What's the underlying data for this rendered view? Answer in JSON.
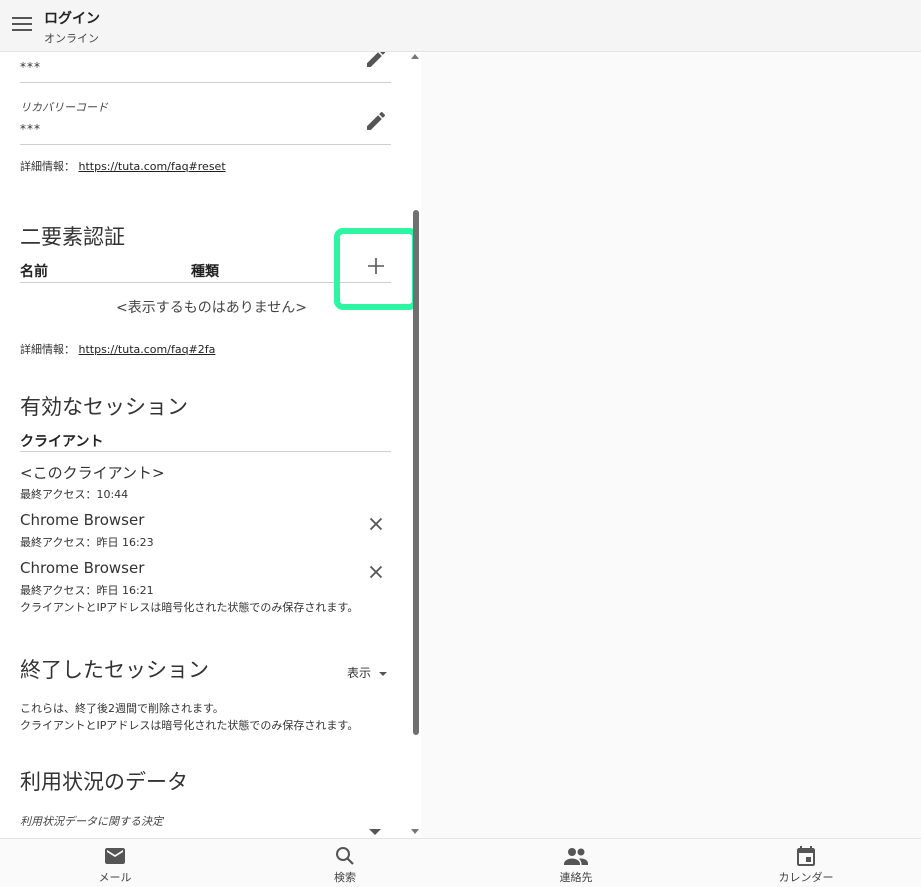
{
  "header": {
    "title": "ログイン",
    "subtitle": "オンライン"
  },
  "password": {
    "value": "***"
  },
  "recovery": {
    "label": "リカバリーコード",
    "value": "***"
  },
  "reset_info": {
    "label": "詳細情報：",
    "link": "https://tuta.com/faq#reset"
  },
  "two_factor": {
    "title": "二要素認証",
    "col_name": "名前",
    "col_type": "種類",
    "empty": "<表示するものはありません>",
    "info_label": "詳細情報：",
    "info_link": "https://tuta.com/faq#2fa"
  },
  "active_sessions": {
    "title": "有効なセッション",
    "col_client": "クライアント",
    "sessions": [
      {
        "name": "<このクライアント>",
        "last_access": "最終アクセス：10:44"
      },
      {
        "name": "Chrome Browser",
        "last_access": "最終アクセス：昨日 16:23"
      },
      {
        "name": "Chrome Browser",
        "last_access": "最終アクセス：昨日 16:21"
      }
    ],
    "note": "クライアントとIPアドレスは暗号化された状態でのみ保存されます。"
  },
  "closed_sessions": {
    "title": "終了したセッション",
    "show_label": "表示",
    "note1": "これらは、終了後2週間で削除されます。",
    "note2": "クライアントとIPアドレスは暗号化された状態でのみ保存されます。"
  },
  "usage_data": {
    "title": "利用状況のデータ",
    "decision_label": "利用状況データに関する決定"
  },
  "nav": {
    "mail": "メール",
    "search": "検索",
    "contacts": "連絡先",
    "calendar": "カレンダー"
  },
  "colors": {
    "highlight": "#2ef5a2",
    "scrollbar": "#707070"
  }
}
